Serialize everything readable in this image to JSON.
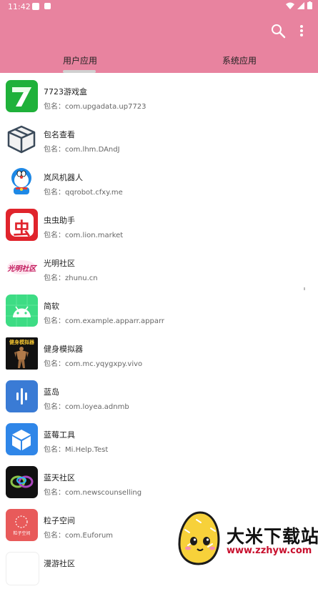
{
  "status_bar": {
    "time": "11:42"
  },
  "toolbar": {
    "search_icon": "search-icon",
    "menu_icon": "more-vert-icon"
  },
  "tabs": [
    {
      "label": "用户应用",
      "selected": true
    },
    {
      "label": "系统应用",
      "selected": false
    }
  ],
  "apps": [
    {
      "name": "7723游戏盒",
      "package": "包名：com.upgadata.up7723",
      "icon": "7723-green-icon"
    },
    {
      "name": "包名查看",
      "package": "包名：com.lhm.DAndJ",
      "icon": "package-box-icon"
    },
    {
      "name": "岚风机器人",
      "package": "包名：qqrobot.cfxy.me",
      "icon": "doraemon-icon"
    },
    {
      "name": "虫虫助手",
      "package": "包名：com.lion.market",
      "icon": "chongchong-icon",
      "icon_text": "虫"
    },
    {
      "name": "光明社区",
      "package": "包名：zhunu.cn",
      "icon": "guangming-icon",
      "icon_text": "光明社区"
    },
    {
      "name": "简软",
      "package": "包名：com.example.apparr.apparr",
      "icon": "android-icon"
    },
    {
      "name": "健身模拟器",
      "package": "包名：com.mc.yqygxpy.vivo",
      "icon": "bodybuilder-icon",
      "icon_text": "健身模拟器"
    },
    {
      "name": "蓝岛",
      "package": "包名：com.loyea.adnmb",
      "icon": "bars-icon"
    },
    {
      "name": "蓝莓工具",
      "package": "包名：Mi.Help.Test",
      "icon": "cube-icon"
    },
    {
      "name": "蓝天社区",
      "package": "包名：com.newscounselling",
      "icon": "rings-icon"
    },
    {
      "name": "粒子空间",
      "package": "包名：com.Euforum",
      "icon": "particle-space-icon",
      "icon_text": "粒子空间"
    },
    {
      "name": "漫游社区",
      "package": "",
      "icon": "manyou-icon"
    }
  ],
  "watermark": {
    "title": "大米下载站",
    "url": "www.zzhyw.com"
  },
  "colors": {
    "header": "#e8839f",
    "indicator": "#d0d0d0",
    "watermark_url": "#c8102e"
  }
}
